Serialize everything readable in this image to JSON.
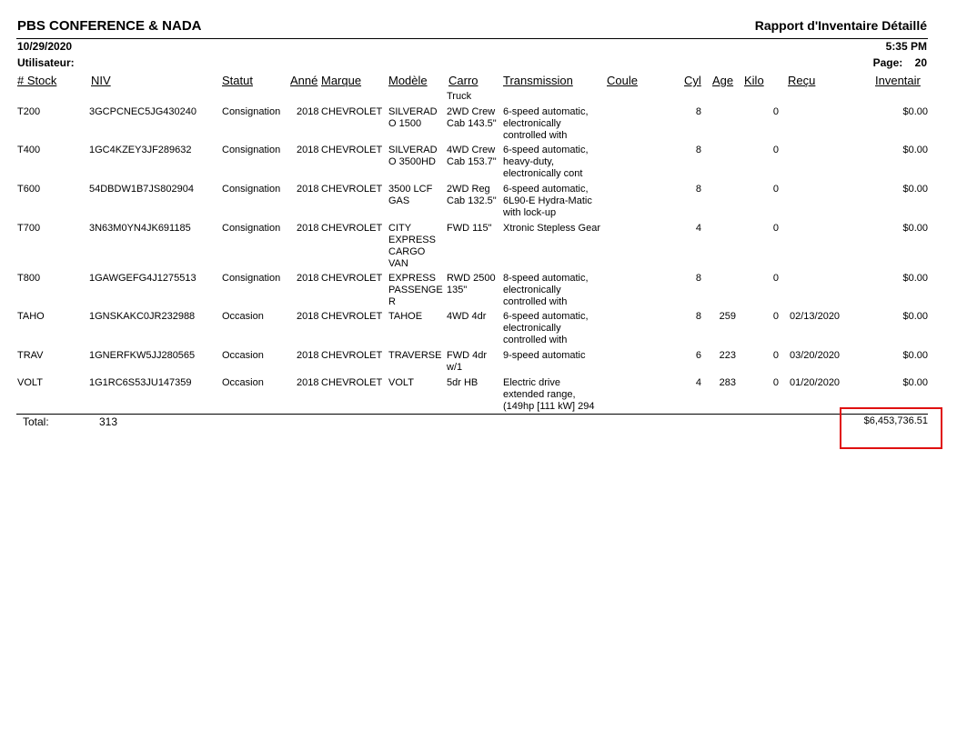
{
  "header": {
    "company": "PBS CONFERENCE & NADA",
    "title": "Rapport d'Inventaire Détaillé",
    "date": "10/29/2020",
    "time": "5:35 PM",
    "user_label": "Utilisateur:",
    "page_label": "Page:",
    "page_number": "20"
  },
  "columns": {
    "stock": "# Stock",
    "niv": "NIV",
    "statut": "Statut",
    "annee": "Anné",
    "marque": "Marque",
    "modele": "Modèle",
    "carro": "Carro",
    "transmission": "Transmission",
    "couleur": "Coule",
    "cyl": "Cyl",
    "age": "Age",
    "kilo": "Kilo",
    "recu": "Reçu",
    "inventaire": "Inventair"
  },
  "carryover_carro": "Truck",
  "rows": [
    {
      "stock": "T200",
      "niv": "3GCPCNEC5JG430240",
      "statut": "Consignation",
      "annee": "2018",
      "marque": "CHEVROLET",
      "modele": "SILVERAD O 1500",
      "carro": "2WD Crew Cab 143.5\"",
      "transmission": "6-speed automatic, electronically controlled with",
      "couleur": "",
      "cyl": "8",
      "age": "",
      "kilo": "0",
      "recu": "",
      "inventaire": "$0.00"
    },
    {
      "stock": "T400",
      "niv": "1GC4KZEY3JF289632",
      "statut": "Consignation",
      "annee": "2018",
      "marque": "CHEVROLET",
      "modele": "SILVERAD O 3500HD",
      "carro": "4WD Crew Cab 153.7\"",
      "transmission": "6-speed automatic, heavy-duty, electronically cont",
      "couleur": "",
      "cyl": "8",
      "age": "",
      "kilo": "0",
      "recu": "",
      "inventaire": "$0.00"
    },
    {
      "stock": "T600",
      "niv": "54DBDW1B7JS802904",
      "statut": "Consignation",
      "annee": "2018",
      "marque": "CHEVROLET",
      "modele": "3500 LCF GAS",
      "carro": "2WD Reg Cab 132.5\"",
      "transmission": "6-speed automatic, 6L90-E Hydra-Matic with lock-up",
      "couleur": "",
      "cyl": "8",
      "age": "",
      "kilo": "0",
      "recu": "",
      "inventaire": "$0.00"
    },
    {
      "stock": "T700",
      "niv": "3N63M0YN4JK691185",
      "statut": "Consignation",
      "annee": "2018",
      "marque": "CHEVROLET",
      "modele": "CITY EXPRESS CARGO VAN",
      "carro": "FWD 115\"",
      "transmission": "Xtronic Stepless Gear",
      "couleur": "",
      "cyl": "4",
      "age": "",
      "kilo": "0",
      "recu": "",
      "inventaire": "$0.00"
    },
    {
      "stock": "T800",
      "niv": "1GAWGEFG4J1275513",
      "statut": "Consignation",
      "annee": "2018",
      "marque": "CHEVROLET",
      "modele": "EXPRESS PASSENGE R",
      "carro": "RWD 2500 135\"",
      "transmission": "8-speed automatic, electronically controlled with",
      "couleur": "",
      "cyl": "8",
      "age": "",
      "kilo": "0",
      "recu": "",
      "inventaire": "$0.00"
    },
    {
      "stock": "TAHO",
      "niv": "1GNSKAKC0JR232988",
      "statut": "Occasion",
      "annee": "2018",
      "marque": "CHEVROLET",
      "modele": "TAHOE",
      "carro": "4WD 4dr",
      "transmission": "6-speed automatic, electronically controlled with",
      "couleur": "",
      "cyl": "8",
      "age": "259",
      "kilo": "0",
      "recu": "02/13/2020",
      "inventaire": "$0.00"
    },
    {
      "stock": "TRAV",
      "niv": "1GNERFKW5JJ280565",
      "statut": "Occasion",
      "annee": "2018",
      "marque": "CHEVROLET",
      "modele": "TRAVERSE",
      "carro": "FWD 4dr w/1",
      "transmission": "9-speed automatic",
      "couleur": "",
      "cyl": "6",
      "age": "223",
      "kilo": "0",
      "recu": "03/20/2020",
      "inventaire": "$0.00"
    },
    {
      "stock": "VOLT",
      "niv": "1G1RC6S53JU147359",
      "statut": "Occasion",
      "annee": "2018",
      "marque": "CHEVROLET",
      "modele": "VOLT",
      "carro": "5dr HB",
      "transmission": "Electric drive extended range, (149hp [111 kW] 294",
      "couleur": "",
      "cyl": "4",
      "age": "283",
      "kilo": "0",
      "recu": "01/20/2020",
      "inventaire": "$0.00"
    }
  ],
  "total": {
    "label": "Total:",
    "count": "313",
    "amount": "$6,453,736.51"
  },
  "highlight_color": "#e01010"
}
